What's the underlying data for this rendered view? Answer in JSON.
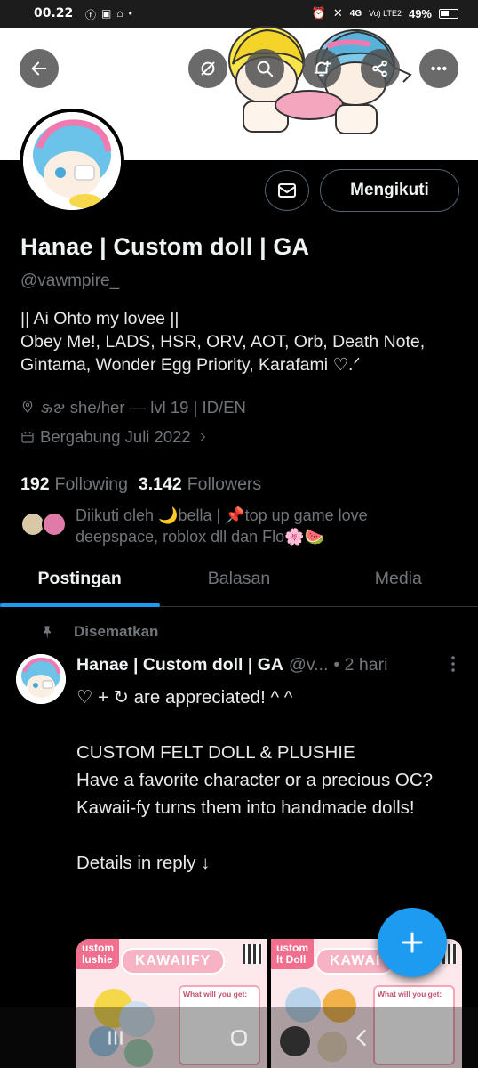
{
  "status_bar": {
    "time": "00.22",
    "network": "4G",
    "volte": "Vo) LTE2",
    "battery": "49%"
  },
  "header": {
    "back_icon": "arrow-left-icon",
    "action_icons": [
      "grok-icon",
      "search-icon",
      "notification-add-icon",
      "share-icon",
      "more-icon"
    ]
  },
  "profile": {
    "name": "Hanae | Custom doll | GA",
    "handle": "@vawmpire_",
    "bio_line1": "|| Ai Ohto my lovee ||",
    "bio_line2": "Obey Me!, LADS, HSR, ORV, AOT, Orb, Death Note, Gintama, Wonder Egg Priority, Karafami ♡.ᐟ",
    "location": "𑄡𑄐 she/her — lvl 19 | ID/EN",
    "joined": "Bergabung Juli 2022",
    "follow_button": "Mengikuti"
  },
  "stats": {
    "following_count": "192",
    "following_label": "Following",
    "followers_count": "3.142",
    "followers_label": "Followers"
  },
  "followed_by": "Diikuti oleh 🌙bella | 📌top up game love deepspace, roblox dll dan Flo🌸🍉",
  "tabs": [
    "Postingan",
    "Balasan",
    "Media"
  ],
  "pinned_label": "Disematkan",
  "tweet": {
    "name": "Hanae | Custom doll | GA",
    "handle": "@v...",
    "time": "• 2 hari",
    "body": "♡ + ↻ are appreciated! ^ ^\n\nCUSTOM FELT DOLL & PLUSHIE\nHave a favorite character or a precious OC?\nKawaii-fy turns them into handmade dolls!\n\nDetails in reply ↓"
  },
  "media": [
    {
      "caption": "ustom\nlushie",
      "title": "KAWAIIFY",
      "panel": "What will you get:"
    },
    {
      "caption": "ustom\nlt Doll",
      "title": "KAWAI",
      "panel": "What will you get:"
    }
  ],
  "colors": {
    "accent": "#1d9bf0",
    "background": "#000000",
    "muted": "#71767b"
  }
}
